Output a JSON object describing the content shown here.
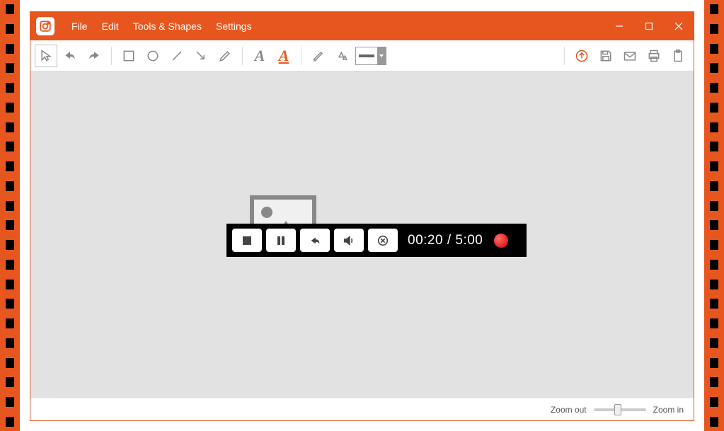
{
  "menu": {
    "file": "File",
    "edit": "Edit",
    "tools": "Tools & Shapes",
    "settings": "Settings"
  },
  "recorder": {
    "elapsed": "00:20",
    "total": "5:00",
    "separator": " / "
  },
  "statusbar": {
    "zoom_out": "Zoom out",
    "zoom_in": "Zoom in"
  },
  "icons": {
    "text_A": "A",
    "text_A_underline": "A"
  }
}
